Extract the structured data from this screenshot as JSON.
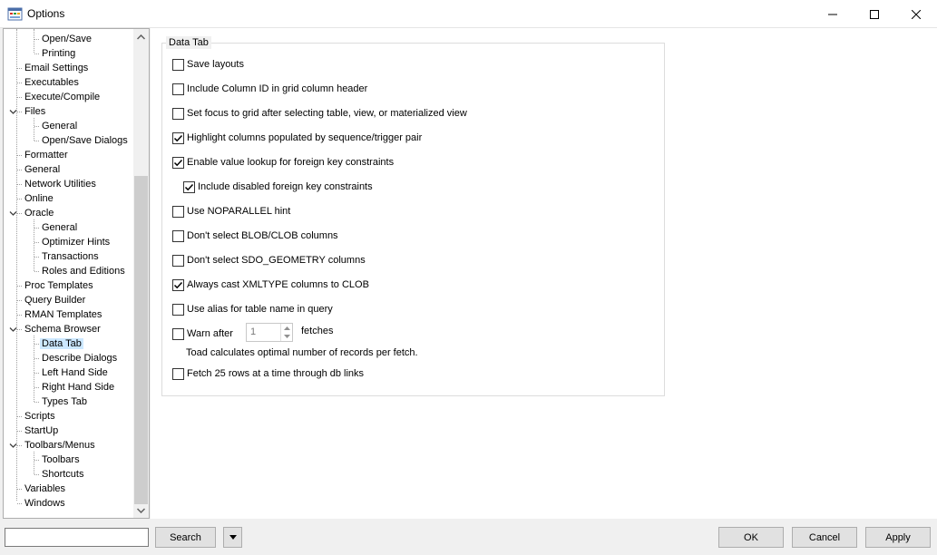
{
  "window": {
    "title": "Options"
  },
  "tree": {
    "items": [
      {
        "label": "Open/Save"
      },
      {
        "label": "Printing"
      },
      {
        "label": "Email Settings"
      },
      {
        "label": "Executables"
      },
      {
        "label": "Execute/Compile"
      },
      {
        "label": "Files"
      },
      {
        "label": "General"
      },
      {
        "label": "Open/Save Dialogs"
      },
      {
        "label": "Formatter"
      },
      {
        "label": "General"
      },
      {
        "label": "Network Utilities"
      },
      {
        "label": "Online"
      },
      {
        "label": "Oracle"
      },
      {
        "label": "General"
      },
      {
        "label": "Optimizer Hints"
      },
      {
        "label": "Transactions"
      },
      {
        "label": "Roles and Editions"
      },
      {
        "label": "Proc Templates"
      },
      {
        "label": "Query Builder"
      },
      {
        "label": "RMAN Templates"
      },
      {
        "label": "Schema Browser"
      },
      {
        "label": "Data Tab"
      },
      {
        "label": "Describe Dialogs"
      },
      {
        "label": "Left Hand Side"
      },
      {
        "label": "Right Hand Side"
      },
      {
        "label": "Types Tab"
      },
      {
        "label": "Scripts"
      },
      {
        "label": "StartUp"
      },
      {
        "label": "Toolbars/Menus"
      },
      {
        "label": "Toolbars"
      },
      {
        "label": "Shortcuts"
      },
      {
        "label": "Variables"
      },
      {
        "label": "Windows"
      }
    ]
  },
  "panel": {
    "group_title": "Data Tab",
    "options": [
      {
        "label": "Save layouts",
        "checked": false
      },
      {
        "label": "Include Column ID in grid column header",
        "checked": false
      },
      {
        "label": "Set focus to grid after selecting table, view, or materialized view",
        "checked": false
      },
      {
        "label": "Highlight columns populated by sequence/trigger pair",
        "checked": true
      },
      {
        "label": "Enable value lookup for foreign key constraints",
        "checked": true
      },
      {
        "label": "Include disabled foreign key constraints",
        "checked": true
      },
      {
        "label": "Use NOPARALLEL hint",
        "checked": false
      },
      {
        "label": "Don't select BLOB/CLOB columns",
        "checked": false
      },
      {
        "label": "Don't select SDO_GEOMETRY columns",
        "checked": false
      },
      {
        "label": "Always cast XMLTYPE columns to CLOB",
        "checked": true
      },
      {
        "label": "Use alias for table name in query",
        "checked": false
      },
      {
        "label": "Warn after",
        "checked": false
      },
      {
        "label": "Fetch 25 rows at a time through db links",
        "checked": false
      }
    ],
    "warn_value": "1",
    "fetches_label": "fetches",
    "hint_text": "Toad calculates optimal number of records per fetch."
  },
  "footer": {
    "search_value": "",
    "search_button": "Search",
    "ok_button": "OK",
    "cancel_button": "Cancel",
    "apply_button": "Apply"
  }
}
